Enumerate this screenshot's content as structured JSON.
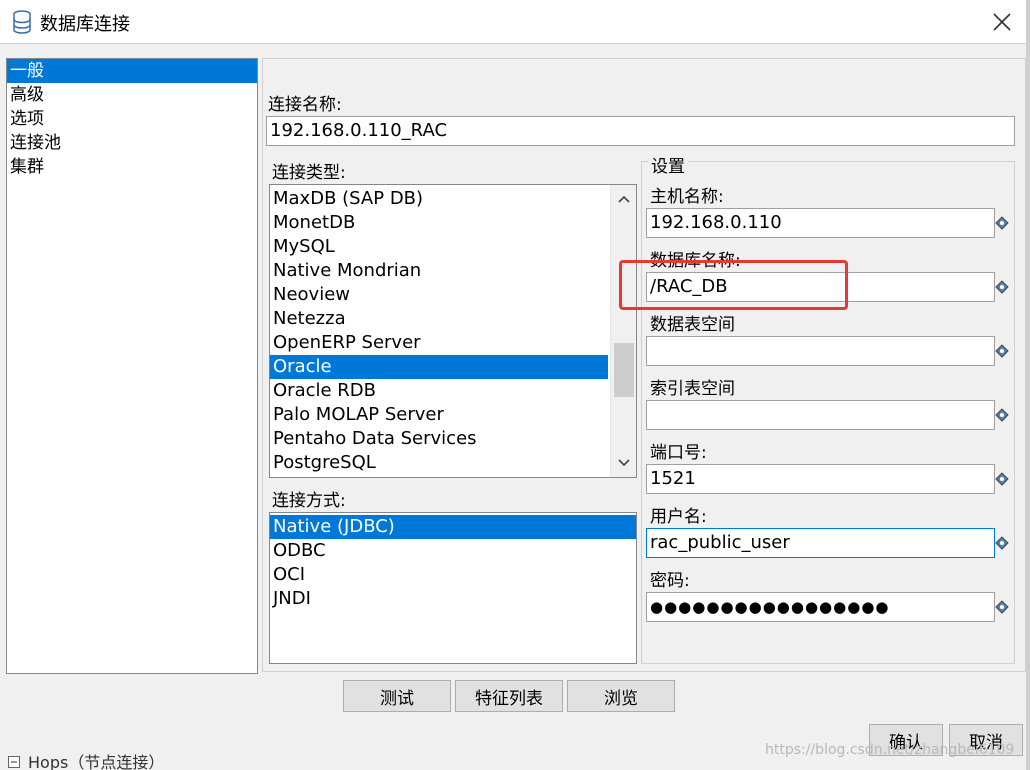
{
  "window": {
    "title": "数据库连接",
    "close_icon": "close-icon"
  },
  "nav": {
    "items": [
      "一般",
      "高级",
      "选项",
      "连接池",
      "集群"
    ],
    "selected_index": 0
  },
  "connection_name": {
    "label": "连接名称:",
    "value": "192.168.0.110_RAC"
  },
  "connection_type": {
    "label": "连接类型:",
    "items": [
      "MaxDB (SAP DB)",
      "MonetDB",
      "MySQL",
      "Native Mondrian",
      "Neoview",
      "Netezza",
      "OpenERP Server",
      "Oracle",
      "Oracle RDB",
      "Palo MOLAP Server",
      "Pentaho Data Services",
      "PostgreSQL"
    ],
    "selected": "Oracle"
  },
  "access_method": {
    "label": "连接方式:",
    "items": [
      "Native (JDBC)",
      "ODBC",
      "OCI",
      "JNDI"
    ],
    "selected": "Native (JDBC)"
  },
  "settings": {
    "title": "设置",
    "host_label": "主机名称:",
    "host_value": "192.168.0.110",
    "db_label": "数据库名称:",
    "db_value": "/RAC_DB",
    "data_tablespace_label": "数据表空间",
    "data_tablespace_value": "",
    "index_tablespace_label": "索引表空间",
    "index_tablespace_value": "",
    "port_label": "端口号:",
    "port_value": "1521",
    "user_label": "用户名:",
    "user_value": "rac_public_user",
    "password_label": "密码:",
    "password_value": "●●●●●●●●●●●●●●●●●"
  },
  "buttons": {
    "test": "测试",
    "features": "特征列表",
    "explore": "浏览",
    "ok": "确认",
    "cancel": "取消"
  },
  "background": {
    "text": "Hops（节点连接）"
  },
  "watermark": "https://blog.csdn.net/zhangbei6109",
  "colors": {
    "selection": "#0078d7",
    "highlight": "#e53935"
  }
}
